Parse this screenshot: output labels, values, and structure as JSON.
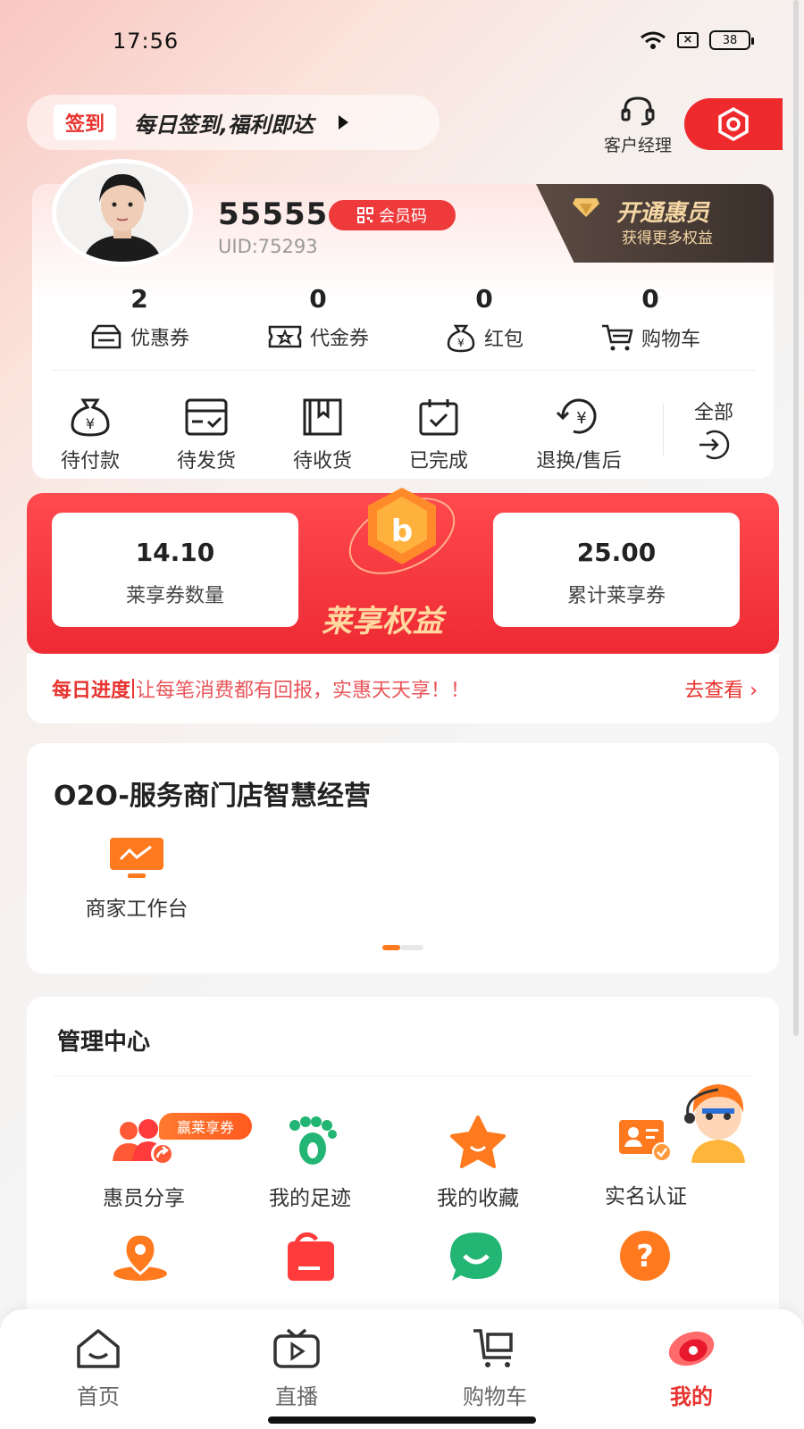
{
  "status": {
    "time": "17:56",
    "battery": "38",
    "sim": "×"
  },
  "checkin": {
    "tag": "签到",
    "text": "每日签到,福利即达"
  },
  "manager": {
    "label": "客户经理"
  },
  "profile": {
    "username": "55555",
    "member_code": "会员码",
    "uid": "UID:75293",
    "vip_title": "开通惠员",
    "vip_sub": "获得更多权益",
    "stats": [
      {
        "num": "2",
        "label": "优惠券"
      },
      {
        "num": "0",
        "label": "代金券"
      },
      {
        "num": "0",
        "label": "红包"
      },
      {
        "num": "0",
        "label": "购物车"
      }
    ],
    "orders": [
      {
        "label": "待付款"
      },
      {
        "label": "待发货"
      },
      {
        "label": "待收货"
      },
      {
        "label": "已完成"
      },
      {
        "label": "退换/售后"
      }
    ],
    "all_label": "全部"
  },
  "banner": {
    "left_num": "14.10",
    "left_label": "莱享券数量",
    "right_num": "25.00",
    "right_label": "累计莱享券",
    "title": "莱享权益",
    "progress_strong": "每日进度",
    "progress_text": "让每笔消费都有回报，实惠天天享！！",
    "progress_link": "去查看"
  },
  "o2o": {
    "title": "O2O-服务商门店智慧经营",
    "item": "商家工作台"
  },
  "manage": {
    "title": "管理中心",
    "badge": "赢莱享券",
    "items": [
      {
        "label": "惠员分享"
      },
      {
        "label": "我的足迹"
      },
      {
        "label": "我的收藏"
      },
      {
        "label": "实名认证"
      }
    ]
  },
  "nav": {
    "items": [
      {
        "label": "首页"
      },
      {
        "label": "直播"
      },
      {
        "label": "购物车"
      },
      {
        "label": "我的"
      }
    ]
  },
  "colors": {
    "accent": "#ee2a2d",
    "orange": "#ff6b1a",
    "green": "#2bbf6a"
  }
}
